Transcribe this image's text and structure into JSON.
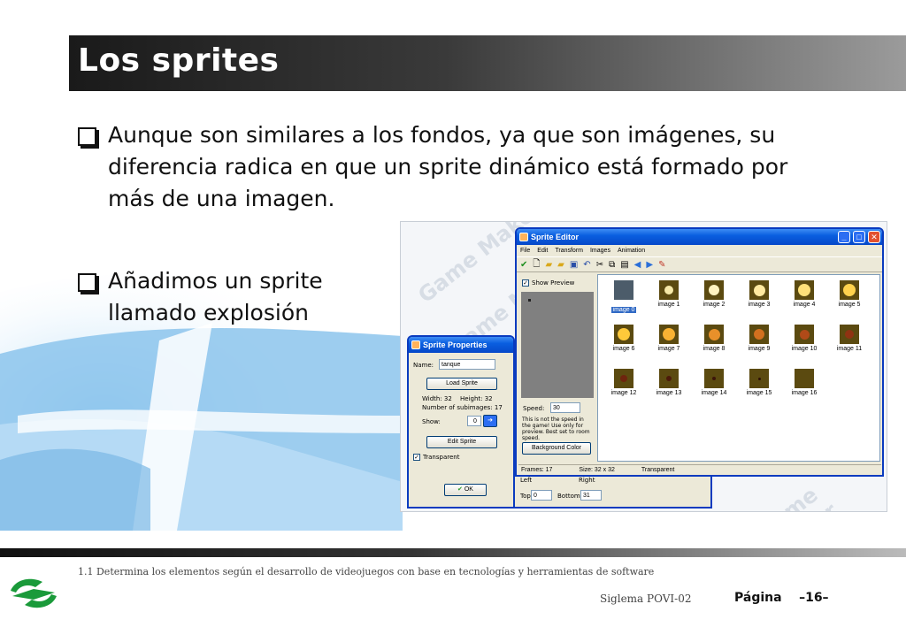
{
  "slide": {
    "title": "Los sprites",
    "bullets": [
      "Aunque son similares a los fondos, ya que son imágenes, su diferencia radica en que un sprite dinámico está formado por más de una imagen.",
      "Añadimos un sprite llamado explosión"
    ]
  },
  "screenshot": {
    "watermark": "Game Maker",
    "sprite_properties": {
      "title": "Sprite Properties",
      "name_label": "Name:",
      "name_value": "tanque",
      "load_button": "Load Sprite",
      "width_text": "Width: 32",
      "height_text": "Height: 32",
      "subimages_text": "Number of subimages: 17",
      "show_label": "Show:",
      "show_value": "0",
      "edit_button": "Edit Sprite",
      "transparent_label": "Transparent",
      "ok_button": "OK",
      "top_label": "Top",
      "top_value": "0",
      "bottom_label": "Bottom",
      "bottom_value": "31",
      "left_label": "Left",
      "right_label": "Right"
    },
    "sprite_editor": {
      "title": "Sprite Editor",
      "menu": [
        "File",
        "Edit",
        "Transform",
        "Images",
        "Animation"
      ],
      "show_preview_label": "Show Preview",
      "speed_label": "Speed:",
      "speed_value": "30",
      "speed_note": "This is not the speed in the game! Use only for preview. Best set to room speed.",
      "background_color_button": "Background Color",
      "images": [
        "image 0",
        "image 1",
        "image 2",
        "image 3",
        "image 4",
        "image 5",
        "image 6",
        "image 7",
        "image 8",
        "image 9",
        "image 10",
        "image 11",
        "image 12",
        "image 13",
        "image 14",
        "image 15",
        "image 16"
      ],
      "selected_index": 0,
      "status": {
        "frames": "Frames: 17",
        "size": "Size: 32 x 32",
        "transparent": "Transparent"
      }
    }
  },
  "footer": {
    "note": "1.1 Determina los elementos según el desarrollo de videojuegos con base en tecnologías y herramientas de software",
    "code": "Siglema  POVI-02",
    "page_label": "Página",
    "page_number": "–16–"
  },
  "colors": {
    "title_bar_dark": "#1a1a1a",
    "bg_blue": "#8cc4ec",
    "logo_green": "#1a9a3a",
    "xp_blue": "#0a5fe0"
  }
}
